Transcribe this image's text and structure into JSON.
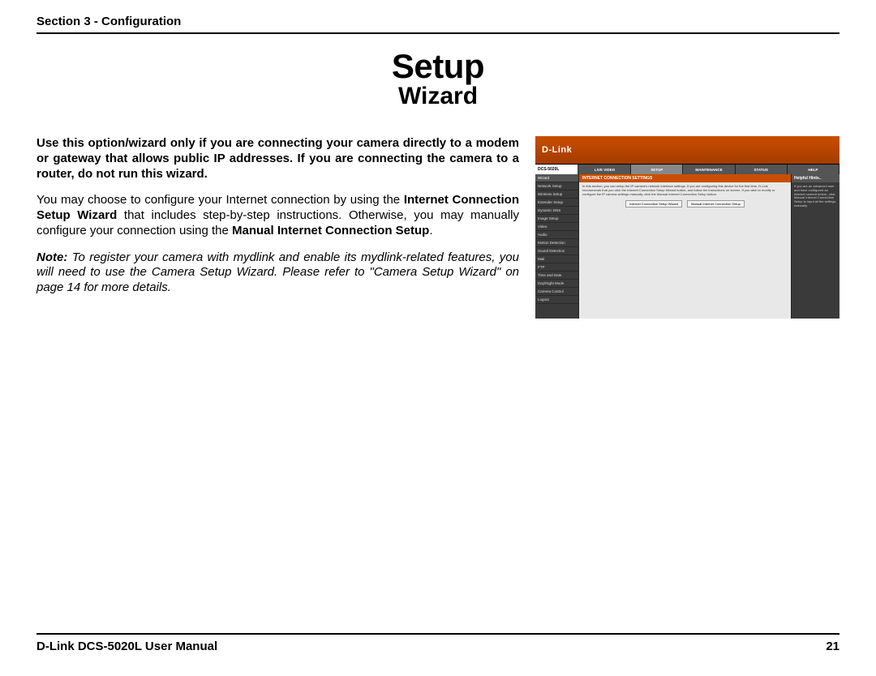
{
  "header": {
    "section_label": "Section 3 - Configuration"
  },
  "title": {
    "main": "Setup",
    "sub": "Wizard"
  },
  "body": {
    "p1_bold": "Use this option/wizard only if you are connecting your camera directly to a modem or gateway that allows public IP addresses. If you are connecting the camera to a router, do not run this wizard.",
    "p2_a": "You may choose to configure your Internet connection by using the ",
    "p2_b_bold": "Internet Connection Setup Wizard",
    "p2_c": " that includes step-by-step instructions. Otherwise, you may manually configure your connection using the ",
    "p2_d_bold": "Manual Internet Connection Setup",
    "p2_e": ".",
    "p3_a_bolditalic": "Note:",
    "p3_b_italic": " To register your camera with mydlink and enable its mydlink-related features, you will need to use the Camera Setup Wizard. Please refer to \"Camera Setup Wizard\" on page 14 for more details."
  },
  "screenshot": {
    "logo": "D-Link",
    "model": "DCS-5020L",
    "tabs": [
      "LIVE VIDEO",
      "SETUP",
      "MAINTENANCE",
      "STATUS",
      "HELP"
    ],
    "active_tab_index": 1,
    "sidebar": [
      "Wizard",
      "Network Setup",
      "Wireless Setup",
      "Extender Setup",
      "Dynamic DNS",
      "Image Setup",
      "Video",
      "Audio",
      "Motion Detection",
      "Sound Detection",
      "Mail",
      "FTP",
      "Time and Date",
      "Day/Night Mode",
      "Camera Control",
      "Logout"
    ],
    "active_side_index": 0,
    "panel_title": "INTERNET CONNECTION SETTINGS",
    "panel_text": "In this section, you can setup the IP camera's network interface settings. If you are configuring this device for the first time, D-Link recommends that you click the Internet Connection Setup Wizard button, and follow the instructions on screen. If you wish to modify or configure the IP camera settings manually, click the Manual Internet Connection Setup button.",
    "btn1": "Internet Connection Setup Wizard",
    "btn2": "Manual Internet Connection Setup",
    "hint_title": "Helpful Hints..",
    "hint_text": "If you are an advanced user and have configured an Internet camera before, click Manual Internet Connection Setup to input all the settings manually."
  },
  "footer": {
    "left": "D-Link DCS-5020L User Manual",
    "right": "21"
  }
}
